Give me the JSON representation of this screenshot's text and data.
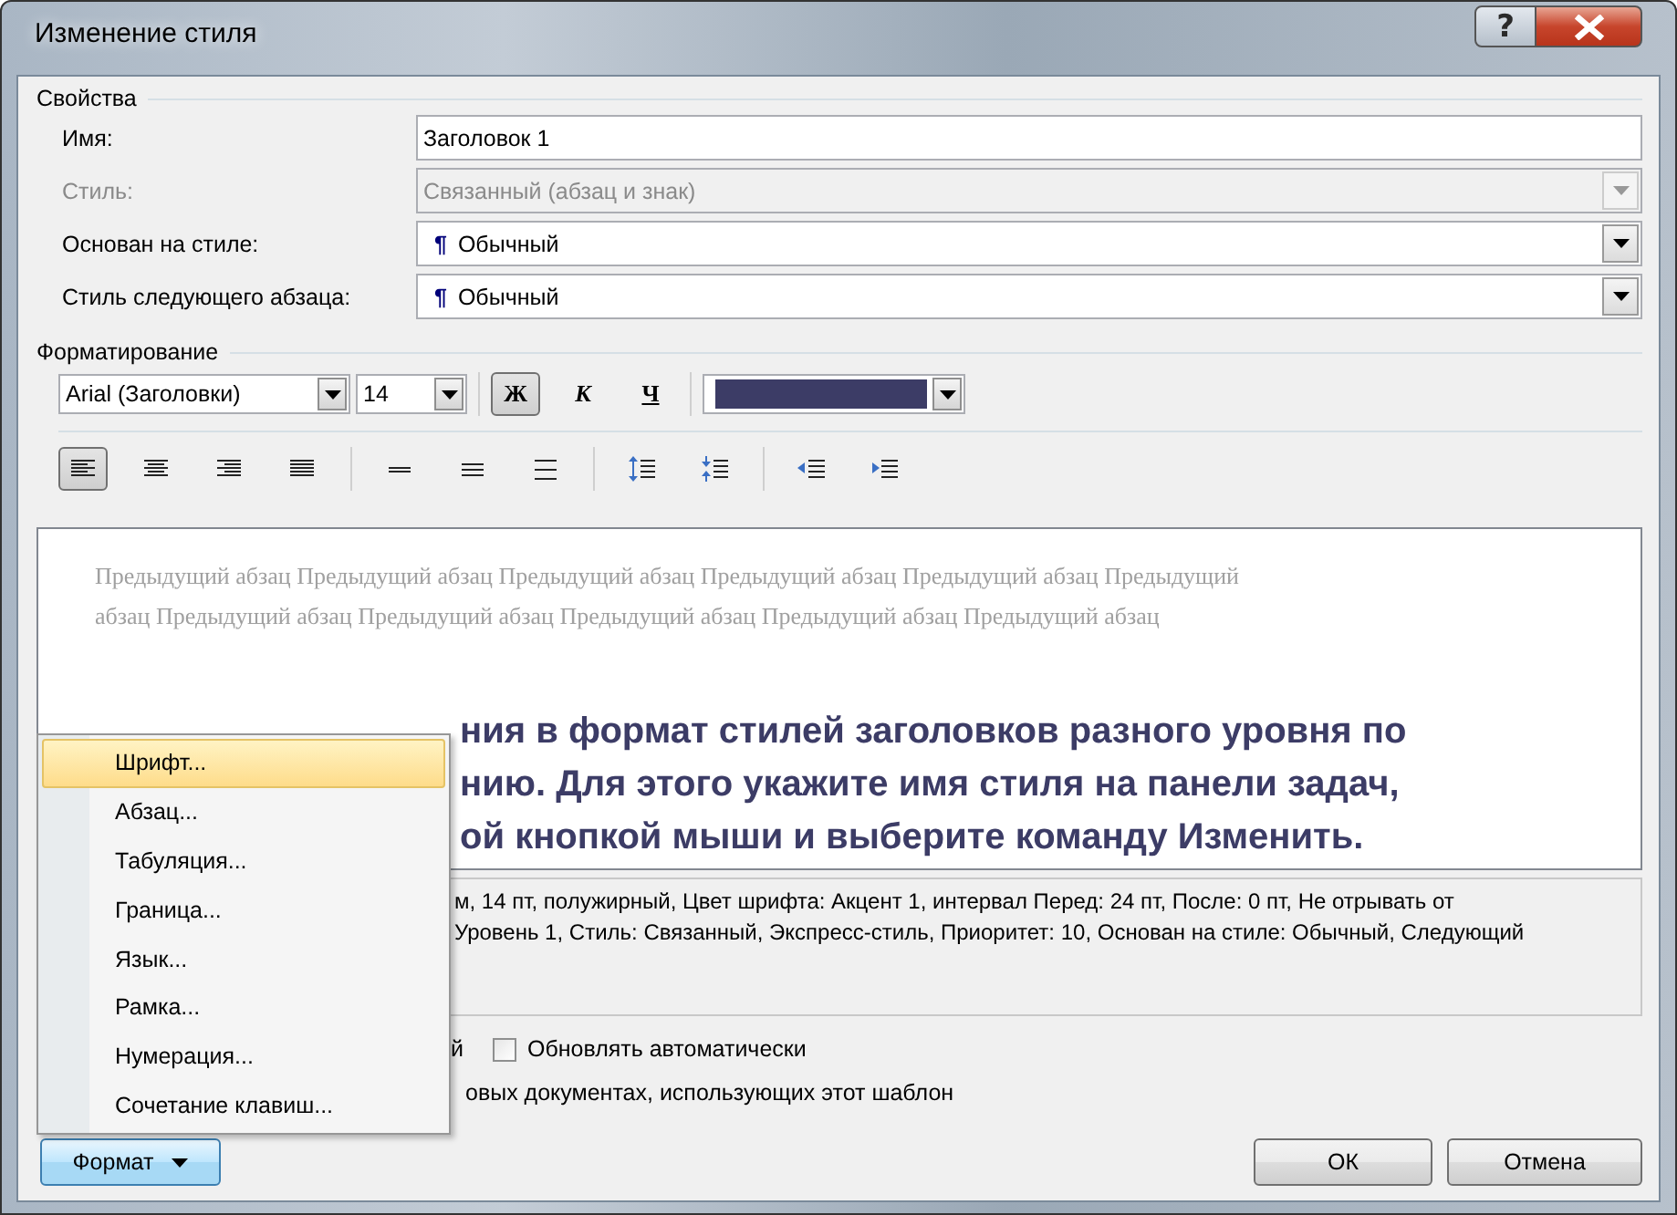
{
  "window": {
    "title": "Изменение стиля",
    "help_button": "?"
  },
  "properties": {
    "legend": "Свойства",
    "fields": [
      {
        "kind": "text",
        "label": "Имя:",
        "value": "Заголовок 1",
        "disabled": false
      },
      {
        "kind": "dropdown",
        "label": "Стиль:",
        "value": "Связанный (абзац и знак)",
        "disabled": true
      },
      {
        "kind": "dropdown",
        "label": "Основан на стиле:",
        "marker": "¶",
        "value": "Обычный",
        "disabled": false
      },
      {
        "kind": "dropdown",
        "label": "Стиль следующего абзаца:",
        "marker": "¶",
        "value": "Обычный",
        "disabled": false
      }
    ]
  },
  "formatting": {
    "legend": "Форматирование",
    "font": "Arial (Заголовки)",
    "size": "14",
    "style_buttons": [
      {
        "kind": "bold",
        "label": "Ж",
        "selected": true
      },
      {
        "kind": "italic",
        "label": "К",
        "selected": false
      },
      {
        "kind": "underline",
        "label": "Ч",
        "selected": false
      }
    ],
    "paragraph_buttons": [
      {
        "kind": "align-left",
        "selected": true
      },
      {
        "kind": "align-center",
        "selected": false
      },
      {
        "kind": "align-right",
        "selected": false
      },
      {
        "kind": "justify",
        "selected": false
      },
      {
        "kind": "single-spacing",
        "selected": false
      },
      {
        "kind": "one-half-spacing",
        "selected": false
      },
      {
        "kind": "double-spacing",
        "selected": false
      },
      {
        "kind": "increase-spacing",
        "selected": false
      },
      {
        "kind": "decrease-spacing",
        "selected": false
      },
      {
        "kind": "decrease-indent",
        "selected": false
      },
      {
        "kind": "increase-indent",
        "selected": false
      }
    ]
  },
  "preview": {
    "previous_paragraph": [
      "Предыдущий абзац Предыдущий абзац Предыдущий абзац Предыдущий абзац Предыдущий абзац Предыдущий",
      "абзац Предыдущий абзац Предыдущий абзац Предыдущий абзац Предыдущий абзац Предыдущий абзац"
    ],
    "sample_lines": [
      "ния в формат стилей заголовков разного уровня по",
      "нию.  Для этого укажите имя стиля на панели задач,",
      "ой кнопкой мыши и выберите команду Изменить."
    ]
  },
  "description": [
    "м, 14 пт, полужирный, Цвет шрифта: Акцент 1, интервал Перед:  24 пт, После:  0 пт, Не отрывать от",
    "Уровень 1, Стиль: Связанный, Экспресс-стиль, Приоритет: 10, Основан на стиле: Обычный, Следующий"
  ],
  "options": [
    {
      "kind": "text",
      "text": "й"
    },
    {
      "kind": "checkbox",
      "label": "Обновлять автоматически",
      "checked": false
    }
  ],
  "options_line": "овых документах, использующих этот шаблон",
  "format_menu": {
    "button": "Формат",
    "items": [
      {
        "label": "Шрифт...",
        "selected": true
      },
      {
        "label": "Абзац...",
        "selected": false
      },
      {
        "label": "Табуляция...",
        "selected": false
      },
      {
        "label": "Граница...",
        "selected": false
      },
      {
        "label": "Язык...",
        "selected": false
      },
      {
        "label": "Рамка...",
        "selected": false
      },
      {
        "label": "Нумерация...",
        "selected": false
      },
      {
        "label": "Сочетание клавиш...",
        "selected": false
      }
    ]
  },
  "buttons": [
    "ОК",
    "Отмена"
  ]
}
